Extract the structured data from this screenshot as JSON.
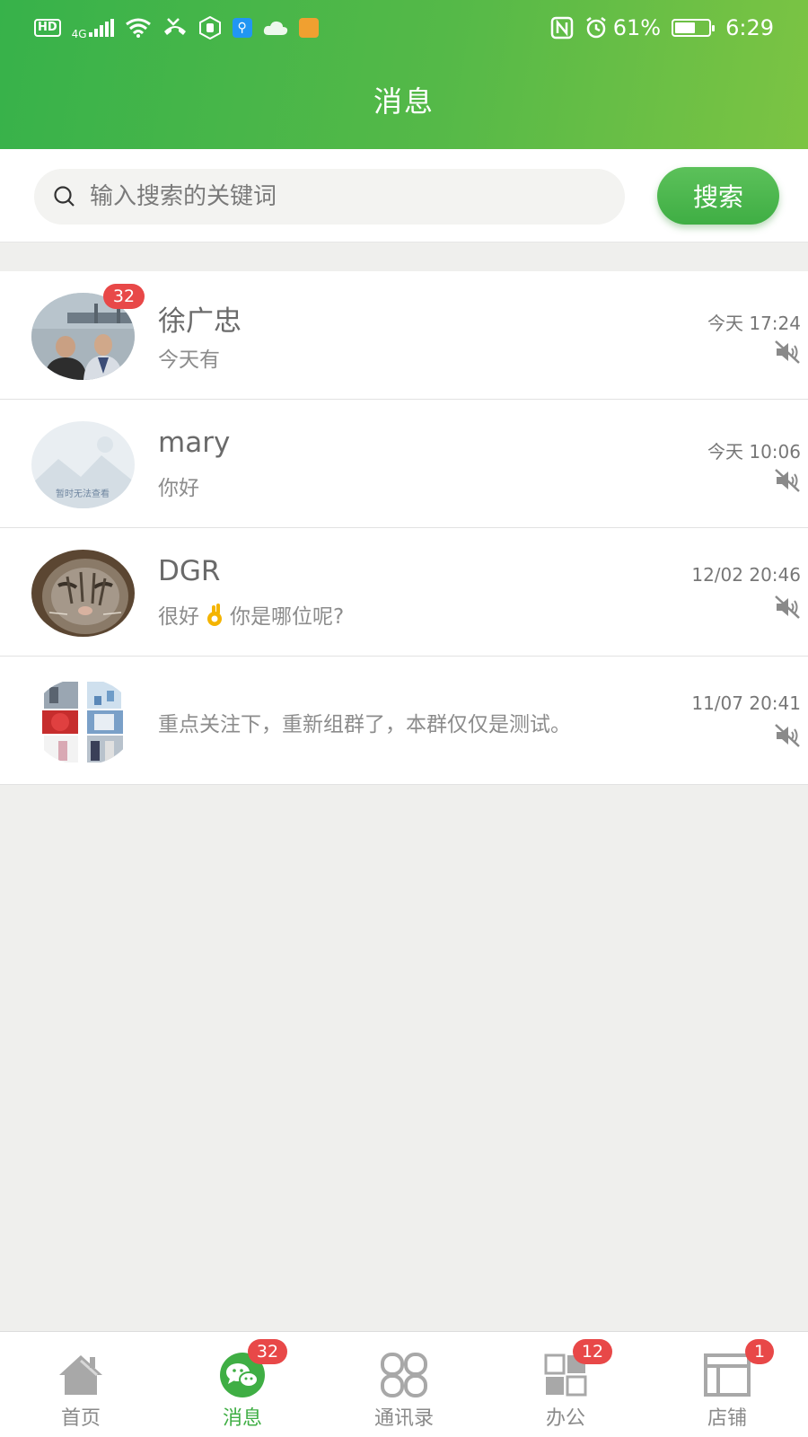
{
  "status_bar": {
    "network_type": "4G",
    "hd_label": "HD",
    "battery": "61%",
    "battery_level": 0.61,
    "time": "6:29"
  },
  "header": {
    "title": "消息"
  },
  "search": {
    "placeholder": "输入搜索的关键词",
    "button_label": "搜索"
  },
  "conversations": [
    {
      "name": "徐广忠",
      "preview": "今天有",
      "time": "今天 17:24",
      "unread": "32",
      "muted": true,
      "avatar": "photo-two-men"
    },
    {
      "name": "mary",
      "preview": "你好",
      "time": "今天 10:06",
      "muted": true,
      "avatar": "placeholder-image",
      "avatar_caption": "暂时无法查看"
    },
    {
      "name": "DGR",
      "preview_before": "很好",
      "preview_emoji": "ok-hand-emoji",
      "preview_after": "你是哪位呢?",
      "time": "12/02 20:46",
      "muted": true,
      "avatar": "photo-cat"
    },
    {
      "name": "",
      "preview": "重点关注下，重新组群了，本群仅仅是测试。",
      "time": "11/07 20:41",
      "muted": true,
      "avatar": "group-collage"
    }
  ],
  "tabs": [
    {
      "label": "首页",
      "icon": "home-icon",
      "active": false
    },
    {
      "label": "消息",
      "icon": "chat-icon",
      "active": true,
      "badge": "32"
    },
    {
      "label": "通讯录",
      "icon": "contacts-icon",
      "active": false
    },
    {
      "label": "办公",
      "icon": "office-icon",
      "active": false,
      "badge": "12"
    },
    {
      "label": "店铺",
      "icon": "store-icon",
      "active": false,
      "badge": "1"
    }
  ],
  "colors": {
    "brand_green": "#3fae44",
    "header_gradient_start": "#37b24a",
    "header_gradient_end": "#7cc443",
    "badge_red": "#e84848"
  }
}
